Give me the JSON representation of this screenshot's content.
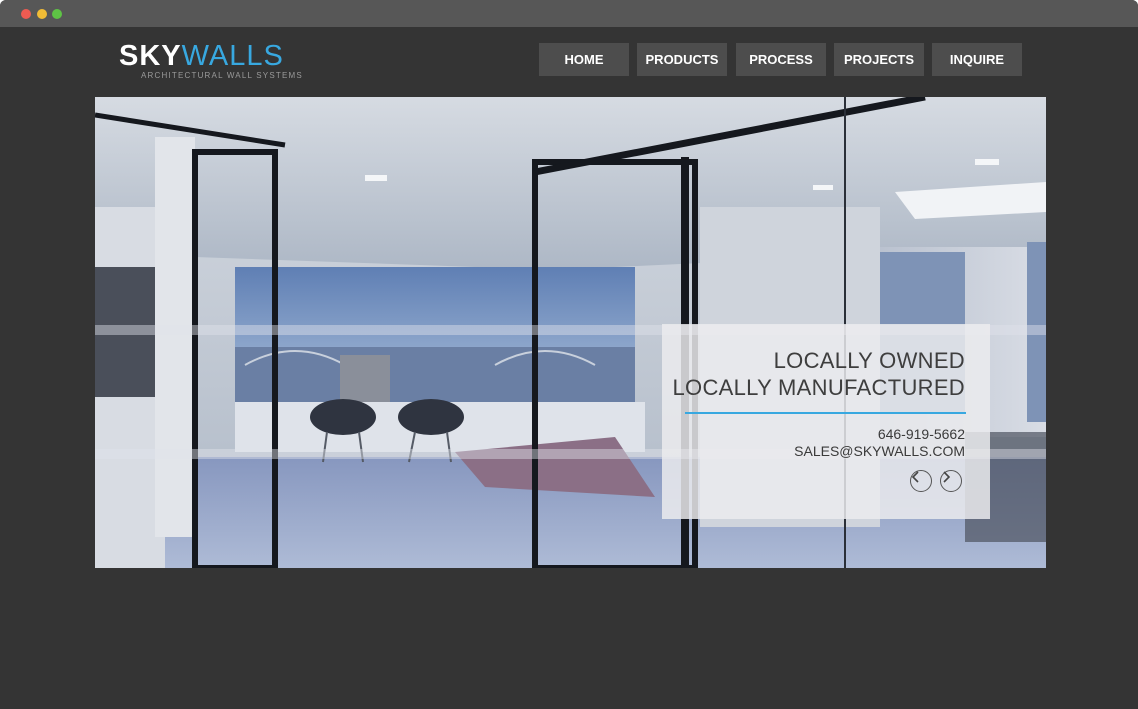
{
  "window": {
    "traffic_lights": [
      "close",
      "minimize",
      "zoom"
    ]
  },
  "logo": {
    "sky": "SKY",
    "walls": "WALLS",
    "tagline": "ARCHITECTURAL WALL SYSTEMS",
    "accent_color": "#38a8e0"
  },
  "nav": {
    "items": [
      {
        "label": "HOME"
      },
      {
        "label": "PRODUCTS"
      },
      {
        "label": "PROCESS"
      },
      {
        "label": "PROJECTS"
      },
      {
        "label": "INQUIRE"
      }
    ]
  },
  "hero": {
    "headline_line1": "LOCALLY OWNED",
    "headline_line2": "LOCALLY MANUFACTURED",
    "phone": "646-919-5662",
    "email": "SALES@SKYWALLS.COM",
    "prev_icon": "chevron-left-icon",
    "next_icon": "chevron-right-icon"
  }
}
